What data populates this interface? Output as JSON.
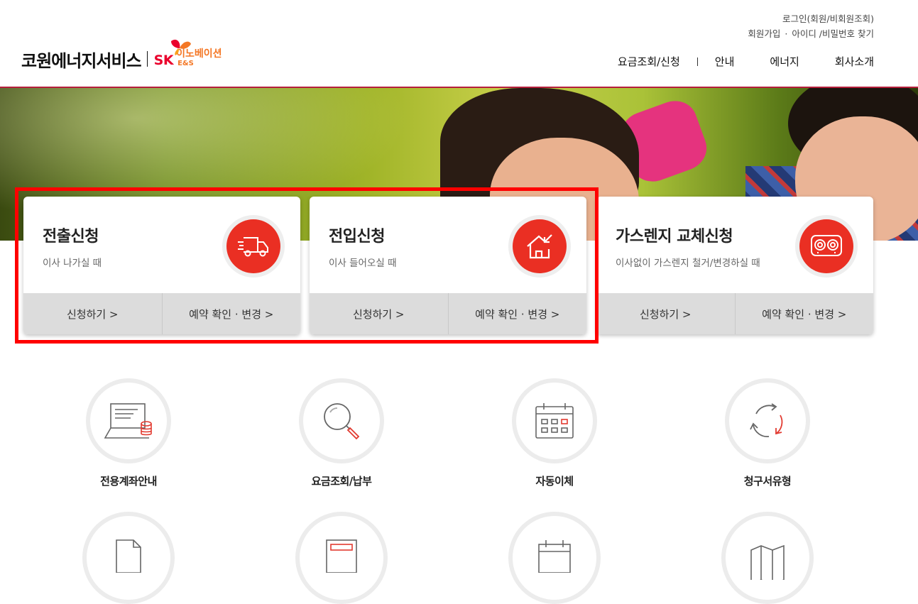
{
  "header": {
    "top_links": {
      "login": "로그인(회원/비회원조회)",
      "signup": "회원가입",
      "find": "아이디 /비밀번호 찾기"
    },
    "logo": {
      "company": "코원에너지서비스",
      "sk": "SK",
      "sub1": "이노베이션",
      "sub2": "E&S"
    },
    "nav": [
      "요금조회/신청",
      "안내",
      "에너지",
      "회사소개"
    ]
  },
  "cards": [
    {
      "title": "전출신청",
      "desc": "이사 나가실 때",
      "icon": "moving-truck-icon",
      "apply": "신청하기 >",
      "check": "예약 확인 · 변경 >"
    },
    {
      "title": "전입신청",
      "desc": "이사 들어오실 때",
      "icon": "house-arrow-icon",
      "apply": "신청하기 >",
      "check": "예약 확인 · 변경 >"
    },
    {
      "title": "가스렌지 교체신청",
      "desc": "이사없이 가스렌지 철거/변경하실 때",
      "icon": "gas-range-icon",
      "apply": "신청하기 >",
      "check": "예약 확인 · 변경 >"
    }
  ],
  "quick_menu": [
    {
      "label": "전용계좌안내",
      "icon": "laptop-coins-icon"
    },
    {
      "label": "요금조회/납부",
      "icon": "magnifier-icon"
    },
    {
      "label": "자동이체",
      "icon": "calendar-icon"
    },
    {
      "label": "청구서유형",
      "icon": "recycle-arrows-icon"
    }
  ],
  "colors": {
    "accent": "#ea2f23",
    "header_line": "#b51e3b",
    "highlight": "#ff0000"
  }
}
